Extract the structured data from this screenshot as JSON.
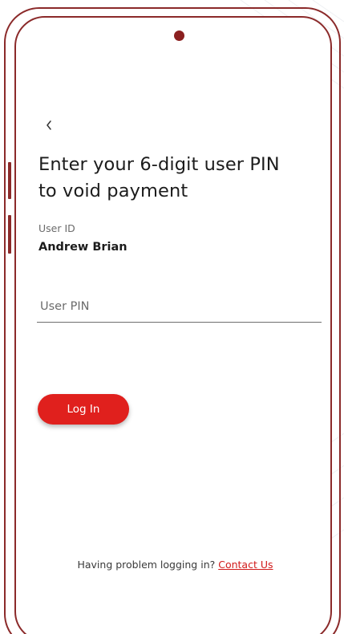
{
  "colors": {
    "frame": "#8b2a2a",
    "primary": "#e0201d",
    "link": "#d11a1a",
    "text": "#1c1c1c",
    "muted": "#6b6b6b"
  },
  "nav": {
    "back_icon": "chevron-left-icon"
  },
  "screen": {
    "title_line1": "Enter your 6-digit user PIN",
    "title_line2": "to void payment"
  },
  "user": {
    "label": "User ID",
    "name": "Andrew Brian"
  },
  "pin": {
    "placeholder": "User PIN",
    "value": ""
  },
  "login": {
    "label": "Log In"
  },
  "help": {
    "prompt": "Having problem logging in?",
    "link_label": "Contact Us"
  }
}
